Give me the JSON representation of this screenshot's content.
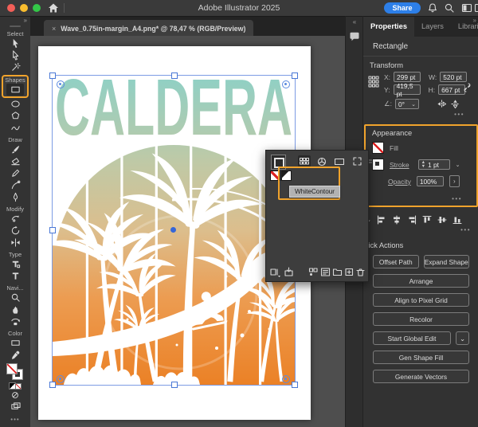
{
  "titlebar": {
    "title": "Adobe Illustrator 2025",
    "share_label": "Share",
    "icons": [
      "home-icon",
      "bell-icon",
      "search-icon",
      "workspace-icon",
      "panel-layout-icon"
    ]
  },
  "tabbar": {
    "close": "×",
    "document": "Wave_0.75in-margin_A4.png* @ 78,47 % (RGB/Preview)"
  },
  "chevrons": {
    "toolbar_collapse": "»",
    "dock_collapse_left": "«",
    "dock_collapse_right": "»"
  },
  "toolbar": {
    "sections": [
      {
        "label": "Select",
        "tools": [
          "selection-tool",
          "direct-selection-tool",
          "magic-wand-tool"
        ]
      },
      {
        "label": "Shapes",
        "tools": [
          "rectangle-tool",
          "ellipse-tool",
          "polygon-tool",
          "shaper-tool"
        ]
      },
      {
        "label": "Draw",
        "tools": [
          "paintbrush-tool",
          "eraser-tool",
          "pencil-tool",
          "curvature-tool",
          "pen-tool"
        ]
      },
      {
        "label": "Modify",
        "tools": [
          "reshape-tool",
          "rotate-tool",
          "width-tool"
        ]
      },
      {
        "label": "Type",
        "tools": [
          "touch-type-tool",
          "type-tool"
        ]
      },
      {
        "label": "Navi...",
        "tools": [
          "zoom-tool",
          "hand-tool",
          "rotate-view-tool"
        ]
      },
      {
        "label": "Color",
        "tools": [
          "gradient-tool",
          "eyedropper-tool"
        ]
      }
    ],
    "more": "•••"
  },
  "artwork": {
    "title": "CALDERA"
  },
  "swatches": {
    "tooltip": "WhiteContour",
    "swatch_names": [
      "none-swatch",
      "white-contour-swatch"
    ],
    "header_icons": [
      "swatches-view-icon",
      "color-wheel-icon",
      "gradient-view-icon",
      "expand-icon"
    ],
    "footer_icons": [
      "libraries-menu-icon",
      "add-to-library-icon",
      "swatch-kinds-icon",
      "swatch-options-icon",
      "new-color-group-icon",
      "new-swatch-icon",
      "delete-swatch-icon"
    ]
  },
  "panel": {
    "tabs": {
      "properties": "Properties",
      "layers": "Layers",
      "libraries": "Libraries"
    },
    "object_type": "Rectangle",
    "transform": {
      "heading": "Transform",
      "x_label": "X:",
      "x": "299 pt",
      "y_label": "Y:",
      "y": "419,5 pt",
      "w_label": "W:",
      "w": "520 pt",
      "h_label": "H:",
      "h": "667 pt",
      "angle_label": "∠:",
      "angle": "0°",
      "more": "•••"
    },
    "appearance": {
      "heading": "Appearance",
      "fill_label": "Fill",
      "stroke_label": "Stroke",
      "stroke_weight": "1 pt",
      "opacity_label": "Opacity",
      "opacity_value": "100%",
      "opacity_more": "›",
      "more": "•••"
    },
    "align": {
      "icons": [
        "align-left-icon",
        "align-h-center-icon",
        "align-right-icon",
        "align-top-icon",
        "align-v-center-icon",
        "align-bottom-icon"
      ],
      "more": "•••"
    },
    "quick_actions": {
      "heading": "Quick Actions",
      "offset_path": "Offset Path",
      "expand_shape": "Expand Shape",
      "arrange": "Arrange",
      "align_pixel": "Align to Pixel Grid",
      "recolor": "Recolor",
      "start_global_edit": "Start Global Edit",
      "gen_shape_fill": "Gen Shape Fill",
      "generate_vectors": "Generate Vectors"
    }
  },
  "colors": {
    "callout_orange": "#F0A32C",
    "selection_blue": "#7D9CE4",
    "share_blue": "#2D7FE8",
    "gradient_top": "#8FD0C5",
    "gradient_mid": "#DCBE8D",
    "gradient_bottom": "#EB8126"
  }
}
